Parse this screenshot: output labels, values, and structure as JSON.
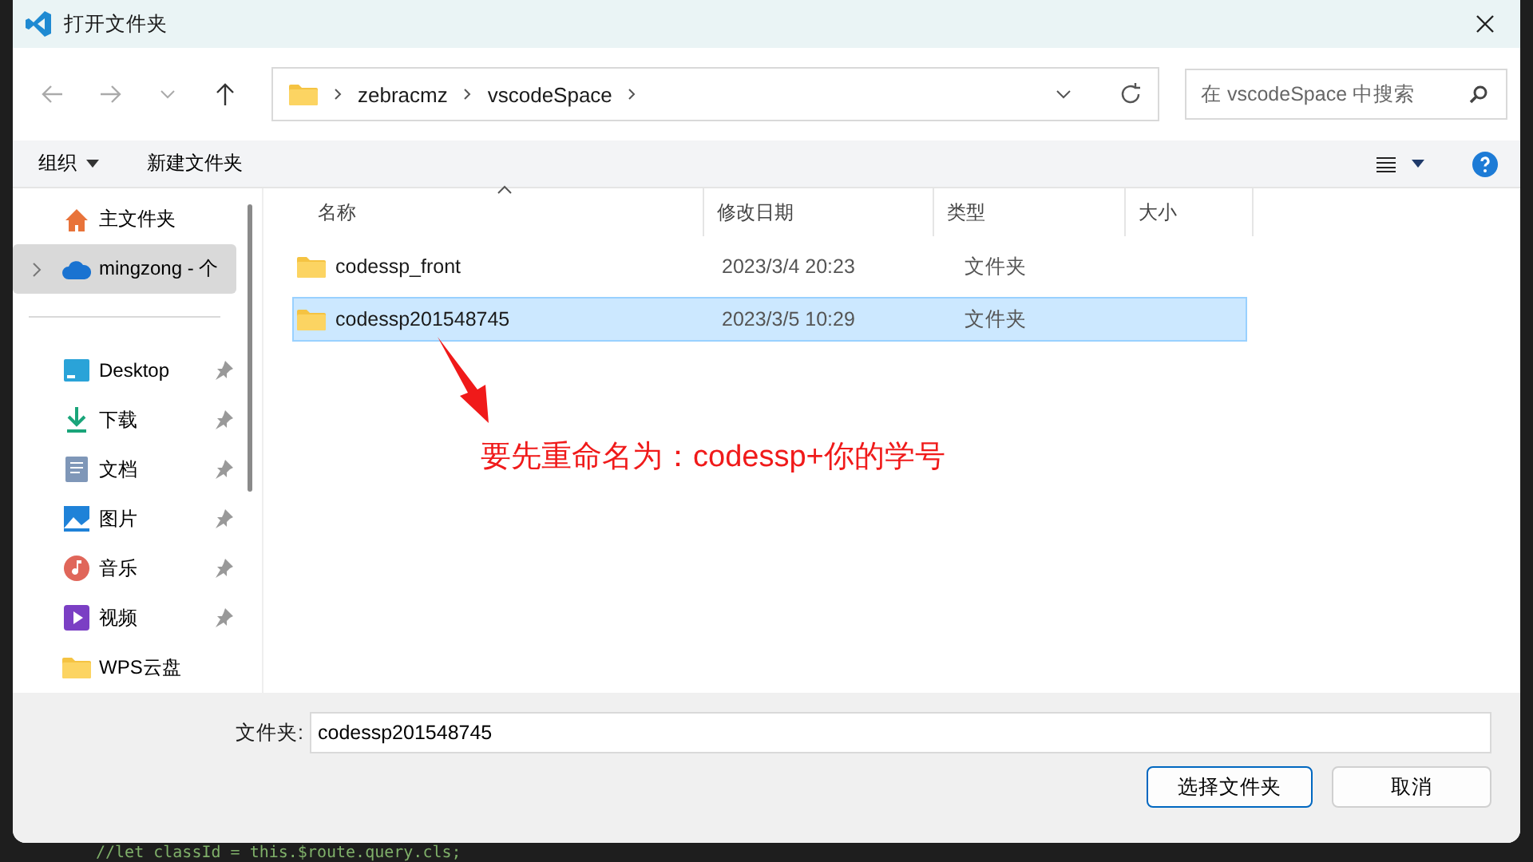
{
  "window": {
    "title": "打开文件夹"
  },
  "address": {
    "crumbs": [
      "zebracmz",
      "vscodeSpace"
    ],
    "search_placeholder": "在 vscodeSpace 中搜索"
  },
  "toolbar": {
    "organize": "组织",
    "new_folder": "新建文件夹"
  },
  "sidebar": {
    "items": [
      {
        "label": "主文件夹",
        "kind": "home",
        "pinned": false,
        "selected": false,
        "expandable": false
      },
      {
        "label": "mingzong - 个",
        "kind": "cloud",
        "pinned": false,
        "selected": true,
        "expandable": true
      },
      {
        "kind": "divider"
      },
      {
        "label": "Desktop",
        "kind": "desktop",
        "pinned": true,
        "selected": false,
        "expandable": false
      },
      {
        "label": "下载",
        "kind": "download",
        "pinned": true,
        "selected": false,
        "expandable": false
      },
      {
        "label": "文档",
        "kind": "document",
        "pinned": true,
        "selected": false,
        "expandable": false
      },
      {
        "label": "图片",
        "kind": "picture",
        "pinned": true,
        "selected": false,
        "expandable": false
      },
      {
        "label": "音乐",
        "kind": "music",
        "pinned": true,
        "selected": false,
        "expandable": false
      },
      {
        "label": "视频",
        "kind": "video",
        "pinned": true,
        "selected": false,
        "expandable": false
      },
      {
        "label": "WPS云盘",
        "kind": "folder",
        "pinned": false,
        "selected": false,
        "expandable": false
      }
    ]
  },
  "table": {
    "columns": [
      "名称",
      "修改日期",
      "类型",
      "大小"
    ],
    "rows": [
      {
        "name": "codessp_front",
        "modified": "2023/3/4 20:23",
        "type": "文件夹",
        "selected": false
      },
      {
        "name": "codessp201548745",
        "modified": "2023/3/5 10:29",
        "type": "文件夹",
        "selected": true
      }
    ]
  },
  "annotation": {
    "text": "要先重命名为：codessp+你的学号"
  },
  "footer": {
    "label": "文件夹:",
    "value": "codessp201548745",
    "buttons": [
      "选择文件夹",
      "取消"
    ]
  },
  "background_code": "//let classId = this.$route.query.cls;"
}
